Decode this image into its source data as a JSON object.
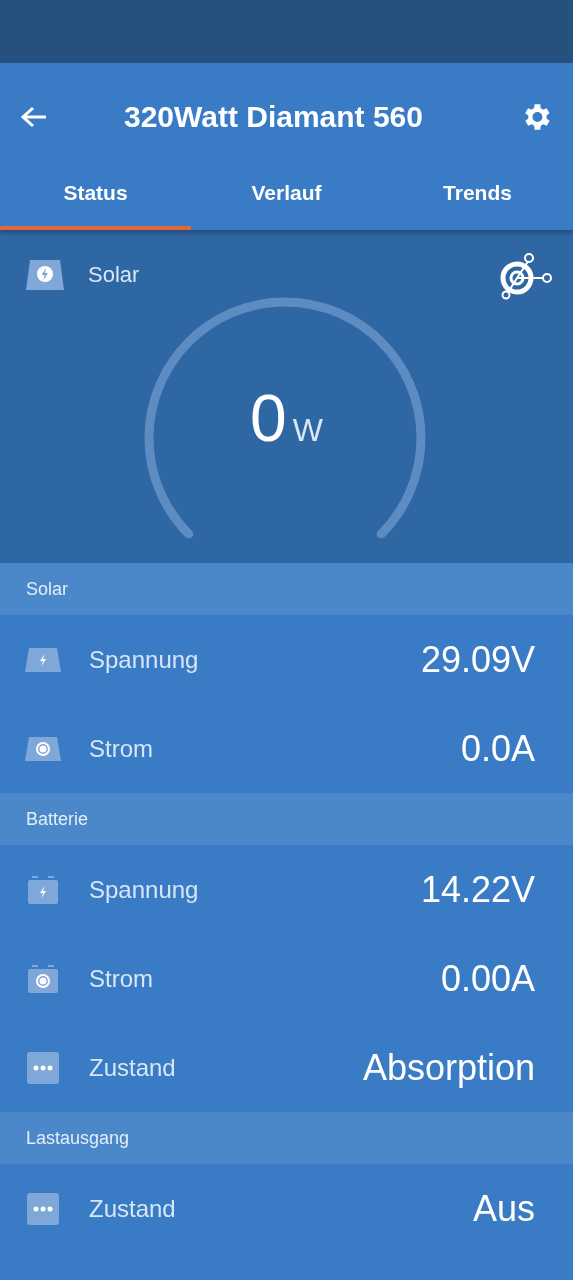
{
  "header": {
    "title": "320Watt Diamant 560"
  },
  "tabs": [
    {
      "label": "Status",
      "selected": true
    },
    {
      "label": "Verlauf",
      "selected": false
    },
    {
      "label": "Trends",
      "selected": false
    }
  ],
  "gauge": {
    "label": "Solar",
    "value": "0",
    "unit": "W"
  },
  "sections": [
    {
      "title": "Solar",
      "rows": [
        {
          "kind": "panel-bolt",
          "label": "Spannung",
          "value": "29.09V"
        },
        {
          "kind": "panel-ring",
          "label": "Strom",
          "value": "0.0A"
        }
      ]
    },
    {
      "title": "Batterie",
      "rows": [
        {
          "kind": "battery-bolt",
          "label": "Spannung",
          "value": "14.22V"
        },
        {
          "kind": "battery-ring",
          "label": "Strom",
          "value": "0.00A"
        },
        {
          "kind": "dots",
          "label": "Zustand",
          "value": "Absorption"
        }
      ]
    },
    {
      "title": "Lastausgang",
      "rows": [
        {
          "kind": "dots",
          "label": "Zustand",
          "value": "Aus"
        }
      ]
    }
  ]
}
